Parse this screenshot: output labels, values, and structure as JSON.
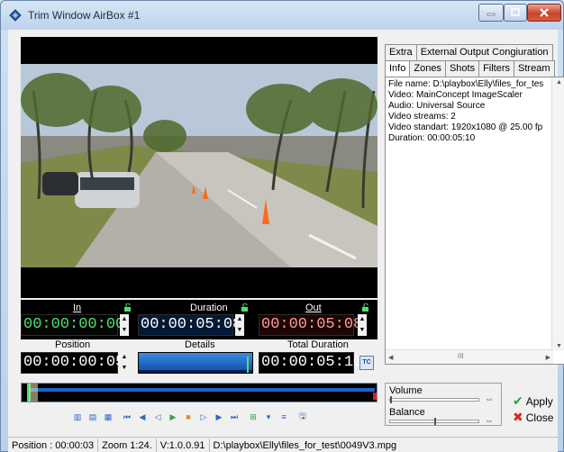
{
  "window": {
    "title": "Trim Window AirBox #1"
  },
  "timecodes": {
    "in_label": "In",
    "in_value": "00:00:00:00",
    "duration_label": "Duration",
    "duration_value": "00:00:05:08",
    "out_label": "Out",
    "out_value": "00:00:05:08",
    "position_label": "Position",
    "position_value": "00:00:00:05",
    "details_label": "Details",
    "total_duration_label": "Total Duration",
    "total_duration_value": "00:00:05:10",
    "tc_button": "TC"
  },
  "tabs": {
    "row1": [
      "Extra",
      "External Output Congiuration"
    ],
    "row2": [
      "Info",
      "Zones",
      "Shots",
      "Filters",
      "Stream"
    ],
    "active": "Info"
  },
  "info": {
    "lines": [
      "File name: D:\\playbox\\Elly\\files_for_tes",
      "Video: MainConcept ImageScaler",
      "Audio: Universal Source",
      "Video streams: 2",
      "Video standart: 1920x1080 @ 25.00 fp",
      "Duration: 00:00:05:10"
    ],
    "hscroll_grip": "III"
  },
  "audio": {
    "volume_label": "Volume",
    "balance_label": "Balance",
    "volume_level": 0.0,
    "balance_level": 0.5
  },
  "actions": {
    "apply_label": "Apply",
    "close_label": "Close"
  },
  "status": {
    "position": "Position : 00:00:03",
    "zoom": "Zoom 1:24.",
    "version": "V:1.0.0.91",
    "file": "D:\\playbox\\Elly\\files_for_test\\0049V3.mpg"
  },
  "colors": {
    "in_tc": "#4ee06a",
    "out_tc": "#ff9a9a",
    "accent": "#1c64c8",
    "apply_check": "#2ea043",
    "close_x": "#d42b1e"
  }
}
